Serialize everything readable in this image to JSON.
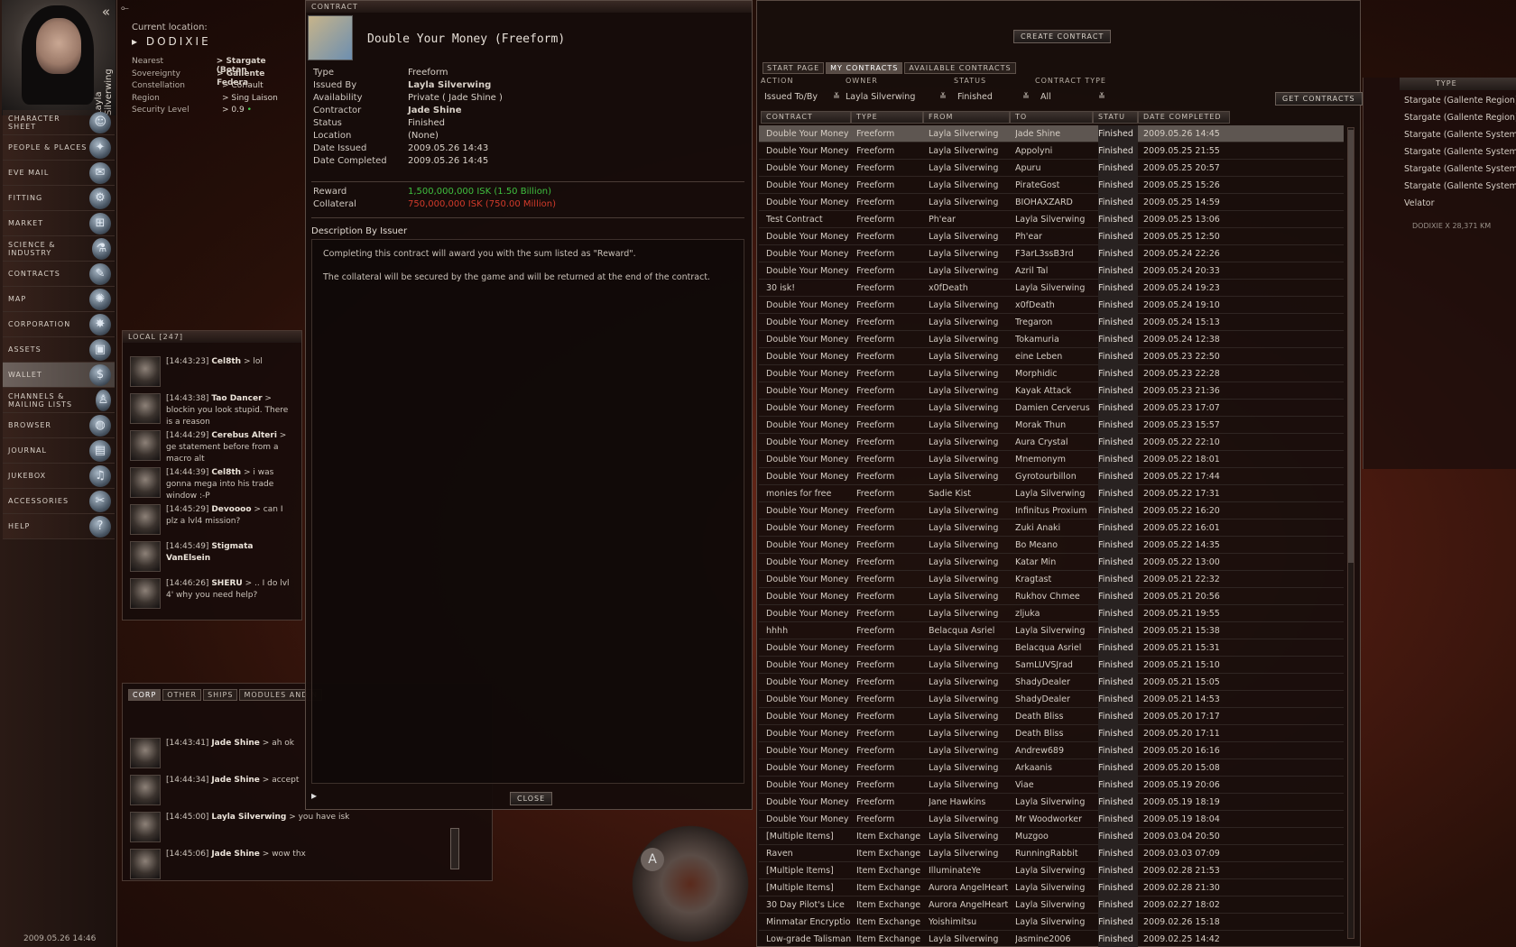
{
  "neocom": {
    "portrait_name": "Layla Silverwing",
    "items": [
      {
        "label": "CHARACTER SHEET",
        "icon": "character-sheet-icon",
        "glyph": "☺"
      },
      {
        "label": "PEOPLE & PLACES",
        "icon": "people-places-icon",
        "glyph": "✦"
      },
      {
        "label": "EVE MAIL",
        "icon": "mail-icon",
        "glyph": "✉"
      },
      {
        "label": "FITTING",
        "icon": "fitting-icon",
        "glyph": "⚙"
      },
      {
        "label": "MARKET",
        "icon": "market-icon",
        "glyph": "⊞"
      },
      {
        "label": "SCIENCE & INDUSTRY",
        "icon": "science-industry-icon",
        "glyph": "⚗"
      },
      {
        "label": "CONTRACTS",
        "icon": "contracts-icon",
        "glyph": "✎"
      },
      {
        "label": "MAP",
        "icon": "map-icon",
        "glyph": "✺"
      },
      {
        "label": "CORPORATION",
        "icon": "corporation-icon",
        "glyph": "✸"
      },
      {
        "label": "ASSETS",
        "icon": "assets-icon",
        "glyph": "▣"
      },
      {
        "label": "WALLET",
        "icon": "wallet-icon",
        "glyph": "$"
      },
      {
        "label": "CHANNELS & MAILING LISTS",
        "icon": "channels-icon",
        "glyph": "♙"
      },
      {
        "label": "BROWSER",
        "icon": "browser-icon",
        "glyph": "◍"
      },
      {
        "label": "JOURNAL",
        "icon": "journal-icon",
        "glyph": "▤"
      },
      {
        "label": "JUKEBOX",
        "icon": "jukebox-icon",
        "glyph": "♫"
      },
      {
        "label": "ACCESSORIES",
        "icon": "accessories-icon",
        "glyph": "✂"
      },
      {
        "label": "HELP",
        "icon": "help-icon",
        "glyph": "?"
      }
    ],
    "active": "WALLET",
    "clock": "2009.05.26 14:46"
  },
  "location": {
    "label": "Current location:",
    "system": "DODIXIE",
    "rows": [
      {
        "k": "Nearest",
        "v": "Stargate (Botan"
      },
      {
        "k": "Sovereignty",
        "v": "Gallente Federa"
      },
      {
        "k": "Constellation",
        "v": "Coriault"
      },
      {
        "k": "Region",
        "v": "Sing Laison"
      },
      {
        "k": "Security Level",
        "v": "0.9"
      }
    ]
  },
  "local_chat": {
    "title": "LOCAL [247]",
    "messages": [
      {
        "time": "[14:43:23]",
        "name": "Cel8th",
        "text": "> lol"
      },
      {
        "time": "[14:43:38]",
        "name": "Tao Dancer",
        "text": "> blockin you look stupid. There is a reason"
      },
      {
        "time": "[14:44:29]",
        "name": "Cerebus Alteri",
        "text": "> ge statement before from a macro alt"
      },
      {
        "time": "[14:44:39]",
        "name": "Cel8th",
        "text": "> i was gonna mega into his trade window :-P"
      },
      {
        "time": "[14:45:29]",
        "name": "Devoooo",
        "text": "> can I plz a lvl4 mission?"
      },
      {
        "time": "[14:45:49]",
        "name": "Stigmata VanElsein",
        "text": ""
      },
      {
        "time": "[14:46:26]",
        "name": "SHERU",
        "text": "> .. I do lvl 4' why you need help?"
      }
    ]
  },
  "private_chat": {
    "tabs": [
      "CORP",
      "OTHER",
      "SHIPS",
      "MODULES AND N"
    ],
    "messages": [
      {
        "time": "[14:43:41]",
        "name": "Jade Shine",
        "text": "> ah ok"
      },
      {
        "time": "[14:44:34]",
        "name": "Jade Shine",
        "text": "> accept"
      },
      {
        "time": "[14:45:00]",
        "name": "Layla Silverwing",
        "text": "> you have isk"
      },
      {
        "time": "[14:45:06]",
        "name": "Jade Shine",
        "text": "> wow thx"
      }
    ]
  },
  "contract": {
    "window_title": "CONTRACT",
    "title": "Double Your Money (Freeform)",
    "details": [
      {
        "k": "Type",
        "v": "Freeform",
        "style": ""
      },
      {
        "k": "Issued By",
        "v": "Layla Silverwing",
        "style": "yellow"
      },
      {
        "k": "Availability",
        "v": "Private ( Jade Shine )",
        "style": ""
      },
      {
        "k": "Contractor",
        "v": "Jade Shine",
        "style": "yellow"
      },
      {
        "k": "Status",
        "v": "Finished",
        "style": ""
      },
      {
        "k": "Location",
        "v": "(None)",
        "style": ""
      },
      {
        "k": "Date Issued",
        "v": "2009.05.26 14:43",
        "style": ""
      },
      {
        "k": "Date Completed",
        "v": "2009.05.26 14:45",
        "style": ""
      }
    ],
    "reward_label": "Reward",
    "reward": "1,500,000,000 ISK (1.50 Billion)",
    "collateral_label": "Collateral",
    "collateral": "750,000,000 ISK (750.00 Million)",
    "desc_title": "Description By Issuer",
    "desc1": "Completing this contract will award you with the sum listed as \"Reward\".",
    "desc2": "The collateral will be secured by the game and will be returned at the end of the contract.",
    "close": "CLOSE",
    "colors": {
      "reward": "#3fbf3f",
      "collateral": "#d23a2a"
    }
  },
  "contracts": {
    "create": "CREATE CONTRACT",
    "tabs": [
      "START PAGE",
      "MY CONTRACTS",
      "AVAILABLE CONTRACTS"
    ],
    "active_tab": "MY CONTRACTS",
    "filters": {
      "action_label": "ACTION",
      "action": "Issued To/By",
      "owner_label": "OWNER",
      "owner": "Layla Silverwing",
      "status_label": "STATUS",
      "status": "Finished",
      "type_label": "CONTRACT TYPE",
      "type": "All",
      "get": "GET CONTRACTS"
    },
    "columns": [
      "CONTRACT",
      "TYPE",
      "FROM",
      "TO",
      "STATU",
      "DATE COMPLETED"
    ],
    "rows": [
      [
        "Double Your Money",
        "Freeform",
        "Layla Silverwing",
        "Jade Shine",
        "Finished",
        "2009.05.26 14:45"
      ],
      [
        "Double Your Money",
        "Freeform",
        "Layla Silverwing",
        "Appolyni",
        "Finished",
        "2009.05.25 21:55"
      ],
      [
        "Double Your Money",
        "Freeform",
        "Layla Silverwing",
        "Apuru",
        "Finished",
        "2009.05.25 20:57"
      ],
      [
        "Double Your Money",
        "Freeform",
        "Layla Silverwing",
        "PirateGost",
        "Finished",
        "2009.05.25 15:26"
      ],
      [
        "Double Your Money",
        "Freeform",
        "Layla Silverwing",
        "BIOHAXZARD",
        "Finished",
        "2009.05.25 14:59"
      ],
      [
        "Test Contract",
        "Freeform",
        "Ph'ear",
        "Layla Silverwing",
        "Finished",
        "2009.05.25 13:06"
      ],
      [
        "Double Your Money",
        "Freeform",
        "Layla Silverwing",
        "Ph'ear",
        "Finished",
        "2009.05.25 12:50"
      ],
      [
        "Double Your Money",
        "Freeform",
        "Layla Silverwing",
        "F3arL3ssB3rd",
        "Finished",
        "2009.05.24 22:26"
      ],
      [
        "Double Your Money",
        "Freeform",
        "Layla Silverwing",
        "Azril Tal",
        "Finished",
        "2009.05.24 20:33"
      ],
      [
        "30 isk!",
        "Freeform",
        "x0fDeath",
        "Layla Silverwing",
        "Finished",
        "2009.05.24 19:23"
      ],
      [
        "Double Your Money",
        "Freeform",
        "Layla Silverwing",
        "x0fDeath",
        "Finished",
        "2009.05.24 19:10"
      ],
      [
        "Double Your Money",
        "Freeform",
        "Layla Silverwing",
        "Tregaron",
        "Finished",
        "2009.05.24 15:13"
      ],
      [
        "Double Your Money",
        "Freeform",
        "Layla Silverwing",
        "Tokamuria",
        "Finished",
        "2009.05.24 12:38"
      ],
      [
        "Double Your Money",
        "Freeform",
        "Layla Silverwing",
        "eine Leben",
        "Finished",
        "2009.05.23 22:50"
      ],
      [
        "Double Your Money",
        "Freeform",
        "Layla Silverwing",
        "Morphidic",
        "Finished",
        "2009.05.23 22:28"
      ],
      [
        "Double Your Money",
        "Freeform",
        "Layla Silverwing",
        "Kayak Attack",
        "Finished",
        "2009.05.23 21:36"
      ],
      [
        "Double Your Money",
        "Freeform",
        "Layla Silverwing",
        "Damien Cerverus",
        "Finished",
        "2009.05.23 17:07"
      ],
      [
        "Double Your Money",
        "Freeform",
        "Layla Silverwing",
        "Morak Thun",
        "Finished",
        "2009.05.23 15:57"
      ],
      [
        "Double Your Money",
        "Freeform",
        "Layla Silverwing",
        "Aura Crystal",
        "Finished",
        "2009.05.22 22:10"
      ],
      [
        "Double Your Money",
        "Freeform",
        "Layla Silverwing",
        "Mnemonym",
        "Finished",
        "2009.05.22 18:01"
      ],
      [
        "Double Your Money",
        "Freeform",
        "Layla Silverwing",
        "Gyrotourbillon",
        "Finished",
        "2009.05.22 17:44"
      ],
      [
        "monies for free",
        "Freeform",
        "Sadie Kist",
        "Layla Silverwing",
        "Finished",
        "2009.05.22 17:31"
      ],
      [
        "Double Your Money",
        "Freeform",
        "Layla Silverwing",
        "Infinitus Proxium",
        "Finished",
        "2009.05.22 16:20"
      ],
      [
        "Double Your Money",
        "Freeform",
        "Layla Silverwing",
        "Zuki Anaki",
        "Finished",
        "2009.05.22 16:01"
      ],
      [
        "Double Your Money",
        "Freeform",
        "Layla Silverwing",
        "Bo Meano",
        "Finished",
        "2009.05.22 14:35"
      ],
      [
        "Double Your Money",
        "Freeform",
        "Layla Silverwing",
        "Katar Min",
        "Finished",
        "2009.05.22 13:00"
      ],
      [
        "Double Your Money",
        "Freeform",
        "Layla Silverwing",
        "Kragtast",
        "Finished",
        "2009.05.21 22:32"
      ],
      [
        "Double Your Money",
        "Freeform",
        "Layla Silverwing",
        "Rukhov Chmee",
        "Finished",
        "2009.05.21 20:56"
      ],
      [
        "Double Your Money",
        "Freeform",
        "Layla Silverwing",
        "zljuka",
        "Finished",
        "2009.05.21 19:55"
      ],
      [
        "hhhh",
        "Freeform",
        "Belacqua Asriel",
        "Layla Silverwing",
        "Finished",
        "2009.05.21 15:38"
      ],
      [
        "Double Your Money",
        "Freeform",
        "Layla Silverwing",
        "Belacqua Asriel",
        "Finished",
        "2009.05.21 15:31"
      ],
      [
        "Double Your Money",
        "Freeform",
        "Layla Silverwing",
        "SamLUVSJrad",
        "Finished",
        "2009.05.21 15:10"
      ],
      [
        "Double Your Money",
        "Freeform",
        "Layla Silverwing",
        "ShadyDealer",
        "Finished",
        "2009.05.21 15:05"
      ],
      [
        "Double Your Money",
        "Freeform",
        "Layla Silverwing",
        "ShadyDealer",
        "Finished",
        "2009.05.21 14:53"
      ],
      [
        "Double Your Money",
        "Freeform",
        "Layla Silverwing",
        "Death Bliss",
        "Finished",
        "2009.05.20 17:17"
      ],
      [
        "Double Your Money",
        "Freeform",
        "Layla Silverwing",
        "Death Bliss",
        "Finished",
        "2009.05.20 17:11"
      ],
      [
        "Double Your Money",
        "Freeform",
        "Layla Silverwing",
        "Andrew689",
        "Finished",
        "2009.05.20 16:16"
      ],
      [
        "Double Your Money",
        "Freeform",
        "Layla Silverwing",
        "Arkaanis",
        "Finished",
        "2009.05.20 15:08"
      ],
      [
        "Double Your Money",
        "Freeform",
        "Layla Silverwing",
        "Viae",
        "Finished",
        "2009.05.19 20:06"
      ],
      [
        "Double Your Money",
        "Freeform",
        "Jane Hawkins",
        "Layla Silverwing",
        "Finished",
        "2009.05.19 18:19"
      ],
      [
        "Double Your Money",
        "Freeform",
        "Layla Silverwing",
        "Mr Woodworker",
        "Finished",
        "2009.05.19 18:04"
      ],
      [
        "[Multiple Items]",
        "Item Exchange",
        "Layla Silverwing",
        "Muzgoo",
        "Finished",
        "2009.03.04 20:50"
      ],
      [
        "Raven",
        "Item Exchange",
        "Layla Silverwing",
        "RunningRabbit",
        "Finished",
        "2009.03.03 07:09"
      ],
      [
        "[Multiple Items]",
        "Item Exchange",
        "IlluminateYe",
        "Layla Silverwing",
        "Finished",
        "2009.02.28 21:53"
      ],
      [
        "[Multiple Items]",
        "Item Exchange",
        "Aurora AngelHeart",
        "Layla Silverwing",
        "Finished",
        "2009.02.28 21:30"
      ],
      [
        "30 Day Pilot's Lice",
        "Item Exchange",
        "Aurora AngelHeart",
        "Layla Silverwing",
        "Finished",
        "2009.02.27 18:02"
      ],
      [
        "Minmatar Encryption",
        "Item Exchange",
        "Yoishimitsu",
        "Layla Silverwing",
        "Finished",
        "2009.02.26 15:18"
      ],
      [
        "Low-grade Talisman",
        "Item Exchange",
        "Layla Silverwing",
        "Jasmine2006",
        "Finished",
        "2009.02.25 14:42"
      ]
    ]
  },
  "overview": {
    "header_type": "TYPE",
    "rows": [
      "Stargate (Gallente Region)",
      "Stargate (Gallente Region)",
      "Stargate (Gallente System)",
      "Stargate (Gallente System)",
      "Stargate (Gallente System)",
      "Stargate (Gallente System)",
      "Velator"
    ],
    "distance": "DODIXIE X 28,371 KM"
  }
}
